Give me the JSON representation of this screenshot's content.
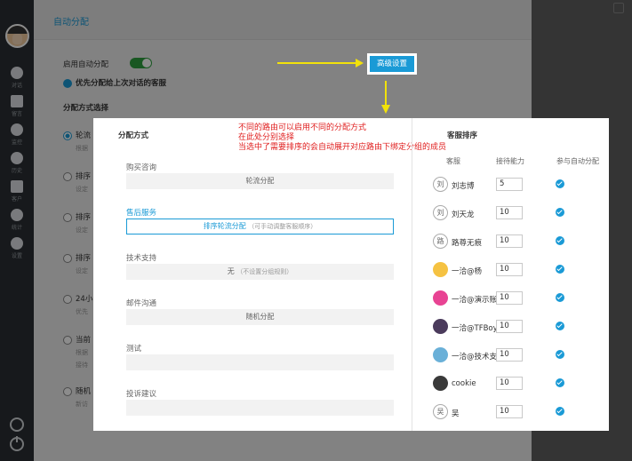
{
  "app": {
    "page_title": "自动分配",
    "enable_label": "启用自动分配",
    "priority_label": "优先分配给上次对话的客服",
    "method_section": "分配方式选择"
  },
  "sidebar": {
    "items": [
      {
        "icon": "chat-icon",
        "label": "对话"
      },
      {
        "icon": "mail-icon",
        "label": "留言"
      },
      {
        "icon": "eye-icon",
        "label": "监控"
      },
      {
        "icon": "clock-icon",
        "label": "历史"
      },
      {
        "icon": "contacts-icon",
        "label": "客户"
      },
      {
        "icon": "pie-chart-icon",
        "label": "统计"
      },
      {
        "icon": "settings-icon",
        "label": "设置"
      }
    ]
  },
  "options": [
    {
      "label": "轮流",
      "sub": "根据",
      "selected": true
    },
    {
      "label": "排序",
      "sub": "设定",
      "selected": false
    },
    {
      "label": "排序",
      "sub": "设定",
      "selected": false
    },
    {
      "label": "排序",
      "sub": "设定",
      "selected": false
    },
    {
      "label": "24小",
      "sub": "优先",
      "selected": false
    },
    {
      "label": "当前",
      "sub": "根据",
      "sub2": "接待",
      "selected": false
    },
    {
      "label": "随机",
      "sub": "新访",
      "selected": false
    }
  ],
  "advanced_button": "高级设置",
  "modal": {
    "left_title": "分配方式",
    "annotation": [
      "不同的路由可以启用不同的分配方式",
      "在此处分别选择",
      "当选中了需要排序的会自动展开对应路由下绑定分组的成员"
    ],
    "routes": [
      {
        "name": "购买咨询",
        "method": "轮流分配",
        "hint": "",
        "active": false
      },
      {
        "name": "售后服务",
        "method": "排序轮流分配",
        "hint": "（可手动调整客服顺序）",
        "active": true
      },
      {
        "name": "技术支持",
        "method": "无",
        "hint": "（不设置分组规则）",
        "active": false
      },
      {
        "name": "邮件沟通",
        "method": "随机分配",
        "hint": "",
        "active": false
      },
      {
        "name": "测试",
        "method": "",
        "hint": "",
        "active": false
      },
      {
        "name": "投诉建议",
        "method": "",
        "hint": "",
        "active": false
      }
    ],
    "right_title": "客服排序",
    "columns": [
      "客服",
      "接待能力",
      "参与自动分配"
    ],
    "agents": [
      {
        "avatar_text": "刘",
        "avatar_color": "",
        "name": "刘志博",
        "capacity": "5",
        "auto": true
      },
      {
        "avatar_text": "刘",
        "avatar_color": "",
        "name": "刘天龙",
        "capacity": "10",
        "auto": true
      },
      {
        "avatar_text": "路",
        "avatar_color": "",
        "name": "路尊无痕",
        "capacity": "10",
        "auto": true
      },
      {
        "avatar_text": "",
        "avatar_color": "#f5c242",
        "name": "一洽@杨",
        "capacity": "10",
        "auto": true
      },
      {
        "avatar_text": "",
        "avatar_color": "#e84393",
        "name": "一洽@演示账",
        "capacity": "10",
        "auto": true
      },
      {
        "avatar_text": "",
        "avatar_color": "#4b3b5c",
        "name": "一洽@TFBoy",
        "capacity": "10",
        "auto": true
      },
      {
        "avatar_text": "",
        "avatar_color": "#6ab0d8",
        "name": "一洽@技术支",
        "capacity": "10",
        "auto": true
      },
      {
        "avatar_text": "",
        "avatar_color": "#3a3a3a",
        "name": "cookie",
        "capacity": "10",
        "auto": true
      },
      {
        "avatar_text": "吴",
        "avatar_color": "",
        "name": "吴",
        "capacity": "10",
        "auto": true
      }
    ]
  },
  "colors": {
    "accent": "#1a9ad6",
    "toggle_on": "#2e9f3f",
    "annotation": "#e02020",
    "arrow": "#f2e20a"
  }
}
